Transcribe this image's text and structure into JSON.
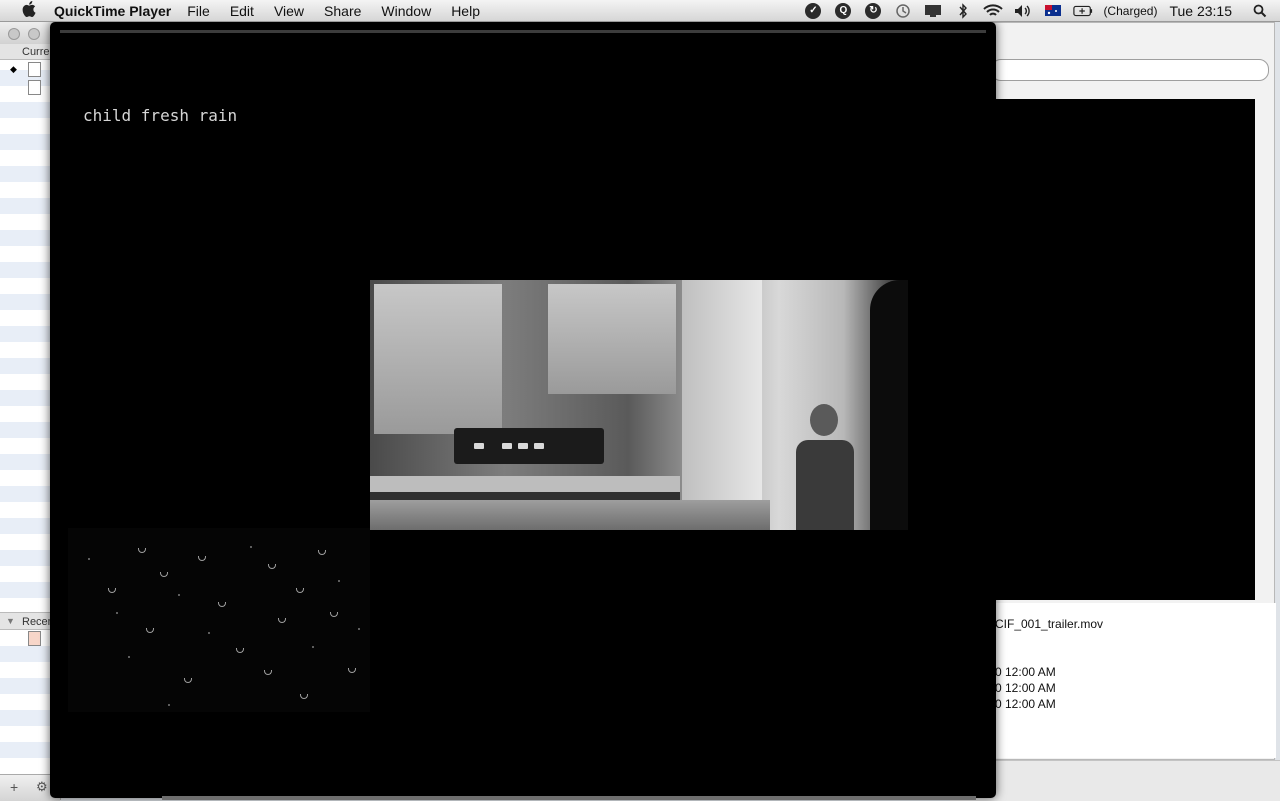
{
  "menubar": {
    "apple_icon": "apple-logo-icon",
    "app_name": "QuickTime Player",
    "menus": [
      "File",
      "Edit",
      "View",
      "Share",
      "Window",
      "Help"
    ],
    "battery_text": "(Charged)",
    "clock": "Tue 23:15",
    "status_icons": [
      "checkbox-icon",
      "q-icon",
      "sync-icon",
      "time-machine-icon",
      "display-icon",
      "bluetooth-icon",
      "wifi-icon",
      "volume-icon",
      "australia-flag-icon",
      "battery-icon",
      "spotlight-icon"
    ]
  },
  "left_window": {
    "section_current": "Curre",
    "section_recent": "Recen"
  },
  "right_window": {
    "file_name": "CIF_001_trailer.mov",
    "dates": [
      "0 12:00 AM",
      "0 12:00 AM",
      "0 12:00 AM"
    ]
  },
  "player": {
    "caption": "child fresh rain"
  }
}
